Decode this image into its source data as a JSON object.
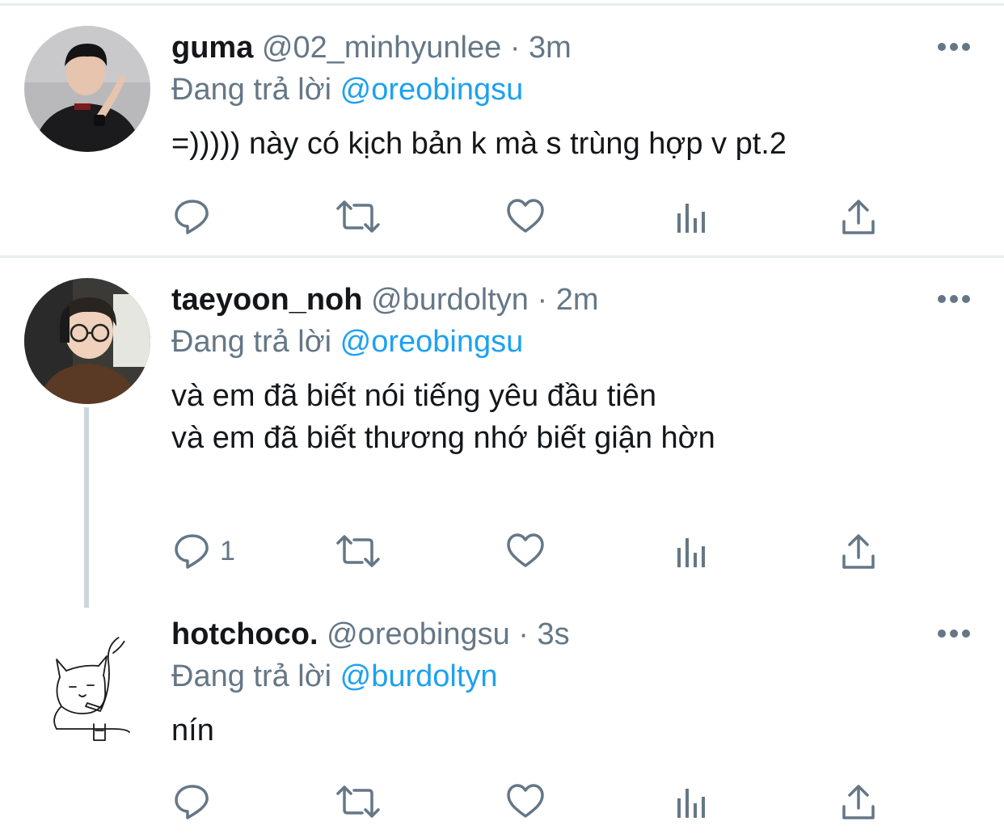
{
  "tweets": [
    {
      "display_name": "guma",
      "handle": "@02_minhyunlee",
      "time": "3m",
      "reply_prefix": "Đang trả lời",
      "reply_to": "@oreobingsu",
      "text": "=))))) này có kịch bản k mà s trùng hợp v pt.2",
      "reply_count": ""
    },
    {
      "display_name": "taeyoon_noh",
      "handle": "@burdoltyn",
      "time": "2m",
      "reply_prefix": "Đang trả lời",
      "reply_to": "@oreobingsu",
      "text": "và em đã biết nói tiếng yêu đầu tiên\nvà em đã biết thương nhớ biết giận hờn",
      "reply_count": "1"
    },
    {
      "display_name": "hotchoco.",
      "handle": "@oreobingsu",
      "time": "3s",
      "reply_prefix": "Đang trả lời",
      "reply_to": "@burdoltyn",
      "text": "nín",
      "reply_count": ""
    }
  ],
  "separator": "·",
  "icons": {
    "reply": "reply-icon",
    "retweet": "retweet-icon",
    "like": "heart-icon",
    "analytics": "analytics-icon",
    "share": "share-icon",
    "more": "more-options-icon"
  },
  "colors": {
    "link": "#1da1f2",
    "secondary": "#657786",
    "icon": "#657786",
    "divider": "#e6ecf0",
    "thread": "#ccd6dd"
  }
}
